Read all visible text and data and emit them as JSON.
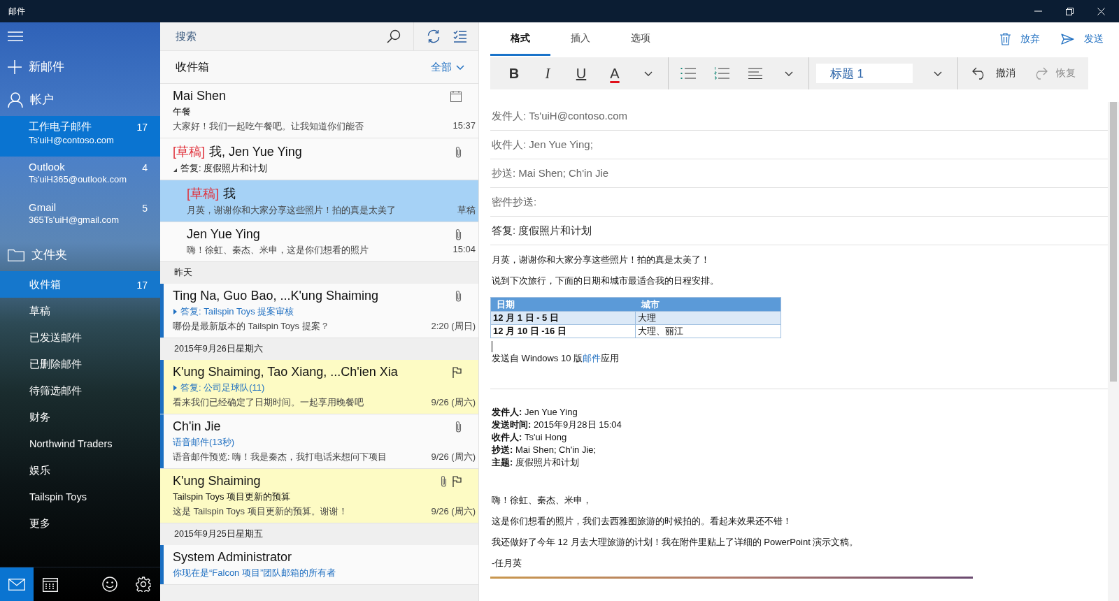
{
  "window": {
    "title": "邮件"
  },
  "sidebar": {
    "new_mail": "新邮件",
    "accounts_label": "帐户",
    "accounts": [
      {
        "name": "工作电子邮件",
        "email": "Ts'uiH@contoso.com",
        "count": "17",
        "selected": true
      },
      {
        "name": "Outlook",
        "email": "Ts'uiH365@outlook.com",
        "count": "4",
        "selected": false
      },
      {
        "name": "Gmail",
        "email": "365Ts'uiH@gmail.com",
        "count": "5",
        "selected": false
      }
    ],
    "folders_label": "文件夹",
    "folders": [
      {
        "name": "收件箱",
        "count": "17",
        "selected": true
      },
      {
        "name": "草稿",
        "selected": false
      },
      {
        "name": "已发送邮件",
        "selected": false
      },
      {
        "name": "已删除邮件",
        "selected": false
      },
      {
        "name": "待筛选邮件",
        "selected": false
      },
      {
        "name": "财务",
        "selected": false
      },
      {
        "name": "Northwind Traders",
        "selected": false
      },
      {
        "name": "娱乐",
        "selected": false
      },
      {
        "name": "Tailspin Toys",
        "selected": false
      },
      {
        "name": "更多",
        "selected": false
      }
    ],
    "bottom_nav": [
      {
        "kind": "mail",
        "selected": true
      },
      {
        "kind": "calendar",
        "selected": false
      },
      {
        "kind": "feedback",
        "selected": false
      },
      {
        "kind": "settings",
        "selected": false
      }
    ]
  },
  "message_list": {
    "search": {
      "placeholder": "搜索"
    },
    "folder_title": "收件箱",
    "filter": "全部",
    "items": [
      {
        "kind": "message",
        "sender": "Mai Shen",
        "subject": "午餐",
        "subject_link": false,
        "preview": "大家好！我们一起吃午餐吧。让我知道你们能否",
        "time": "15:37",
        "meeting": true,
        "attachment": false,
        "flagged": false,
        "unread": false,
        "selected": false
      },
      {
        "kind": "message",
        "tag": "[草稿]",
        "sender": "我, Jen Yue Ying",
        "subject": "答复: 度假照片和计划",
        "subject_link": false,
        "expanded": true,
        "attachment": true,
        "flagged": false,
        "unread": false,
        "selected": false,
        "children": [
          {
            "kind": "message",
            "tag": "[草稿]",
            "sender": "我",
            "preview": "月英，谢谢你和大家分享这些照片！拍的真是太美了",
            "time": "草稿",
            "attachment": false,
            "flagged": false,
            "unread": false,
            "selected": true
          },
          {
            "kind": "message",
            "sender": "Jen Yue Ying",
            "preview": "嗨！徐虹、秦杰、米申，这是你们想看的照片",
            "time": "15:04",
            "attachment": true,
            "flagged": false,
            "unread": false,
            "selected": false
          }
        ]
      },
      {
        "kind": "date",
        "label": "昨天"
      },
      {
        "kind": "message",
        "sender": "Ting Na, Guo Bao, ...K'ung Shaiming",
        "subject": "答复: Tailspin Toys 提案审核",
        "subject_link": true,
        "expanded": false,
        "preview": "哪份是最新版本的 Tailspin Toys 提案？",
        "time": "2:20 (周日)",
        "attachment": true,
        "flagged": false,
        "unread": true,
        "selected": false
      },
      {
        "kind": "date",
        "label": "2015年9月26日星期六"
      },
      {
        "kind": "message",
        "sender": "K'ung Shaiming, Tao Xiang, ...Ch'ien Xia",
        "subject": "答复: 公司足球队(11)",
        "subject_link": true,
        "expanded": false,
        "preview": "看来我们已经确定了日期时间。一起享用晚餐吧",
        "time": "9/26 (周六)",
        "attachment": false,
        "flagged": true,
        "unread": true,
        "selected": false
      },
      {
        "kind": "message",
        "sender": "Ch'in Jie",
        "subject": "语音邮件(13秒)",
        "subject_link": true,
        "preview": "语音邮件预览: 嗨！我是秦杰，我打电话来想问下项目",
        "time": "9/26 (周六)",
        "attachment": true,
        "flagged": false,
        "unread": true,
        "selected": false
      },
      {
        "kind": "message",
        "sender": "K'ung Shaiming",
        "subject": "Tailspin Toys 项目更新的预算",
        "subject_link": false,
        "preview": "这是 Tailspin Toys 项目更新的预算。谢谢！",
        "time": "9/26 (周六)",
        "attachment": true,
        "flagged": true,
        "unread": false,
        "selected": false
      },
      {
        "kind": "date",
        "label": "2015年9月25日星期五"
      },
      {
        "kind": "message",
        "sender": "System Administrator",
        "subject": "你现在是“Falcon 项目”团队邮箱的所有者",
        "subject_link": true,
        "attachment": false,
        "flagged": false,
        "unread": true,
        "selected": false
      }
    ]
  },
  "compose": {
    "tabs": [
      {
        "label": "格式",
        "selected": true
      },
      {
        "label": "插入",
        "selected": false
      },
      {
        "label": "选项",
        "selected": false
      }
    ],
    "actions": [
      {
        "kind": "discard",
        "label": "放弃"
      },
      {
        "kind": "send",
        "label": "发送"
      }
    ],
    "toolbar": [
      {
        "kind": "bold",
        "label": "B"
      },
      {
        "kind": "italic",
        "label": "I"
      },
      {
        "kind": "underline",
        "label": "U"
      },
      {
        "kind": "font_color",
        "label": "A"
      },
      {
        "kind": "more"
      },
      {
        "kind": "divider"
      },
      {
        "kind": "bullets"
      },
      {
        "kind": "numbering"
      },
      {
        "kind": "align"
      },
      {
        "kind": "more"
      },
      {
        "kind": "divider"
      },
      {
        "kind": "style",
        "value": "标题 1"
      },
      {
        "kind": "more"
      },
      {
        "kind": "divider"
      },
      {
        "kind": "undo",
        "label": "撤消",
        "disabled": false
      },
      {
        "kind": "redo",
        "label": "恢复",
        "disabled": true
      }
    ],
    "fields": [
      {
        "text": "发件人: Ts'uiH@contoso.com"
      },
      {
        "text": "收件人: Jen Yue Ying;"
      },
      {
        "text": "抄送: Mai Shen; Ch'in Jie"
      },
      {
        "text": "密件抄送:"
      }
    ],
    "subject": "答复: 度假照片和计划",
    "paragraphs": [
      "月英，谢谢你和大家分享这些照片！拍的真是太美了！",
      "说到下次旅行，下面的日期和城市最适合我的日程安排。"
    ],
    "table": {
      "columns": [
        "日期",
        "城市"
      ],
      "rows": [
        [
          "12 月 1 日 - 5 日",
          "大理"
        ],
        [
          "12 月 10 日 -16 日",
          "大理、丽江"
        ]
      ]
    },
    "signature": {
      "before": "发送自 Windows 10 版",
      "link": "邮件",
      "after": "应用"
    },
    "quoted": {
      "header": [
        "**发件人:** Jen Yue Ying",
        "**发送时间:** 2015年9月28日 15:04",
        "**收件人:** Ts'ui Hong",
        "**抄送:** Mai Shen; Ch'in Jie;",
        "**主题:** 度假照片和计划"
      ],
      "paragraphs": [
        "嗨！徐虹、秦杰、米申，",
        "这是你们想看的照片，我们去西雅图旅游的时候拍的。看起来效果还不错！",
        "我还做好了今年 12 月去大理旅游的计划！我在附件里贴上了详细的 PowerPoint 演示文稿。",
        "-任月英"
      ]
    }
  }
}
